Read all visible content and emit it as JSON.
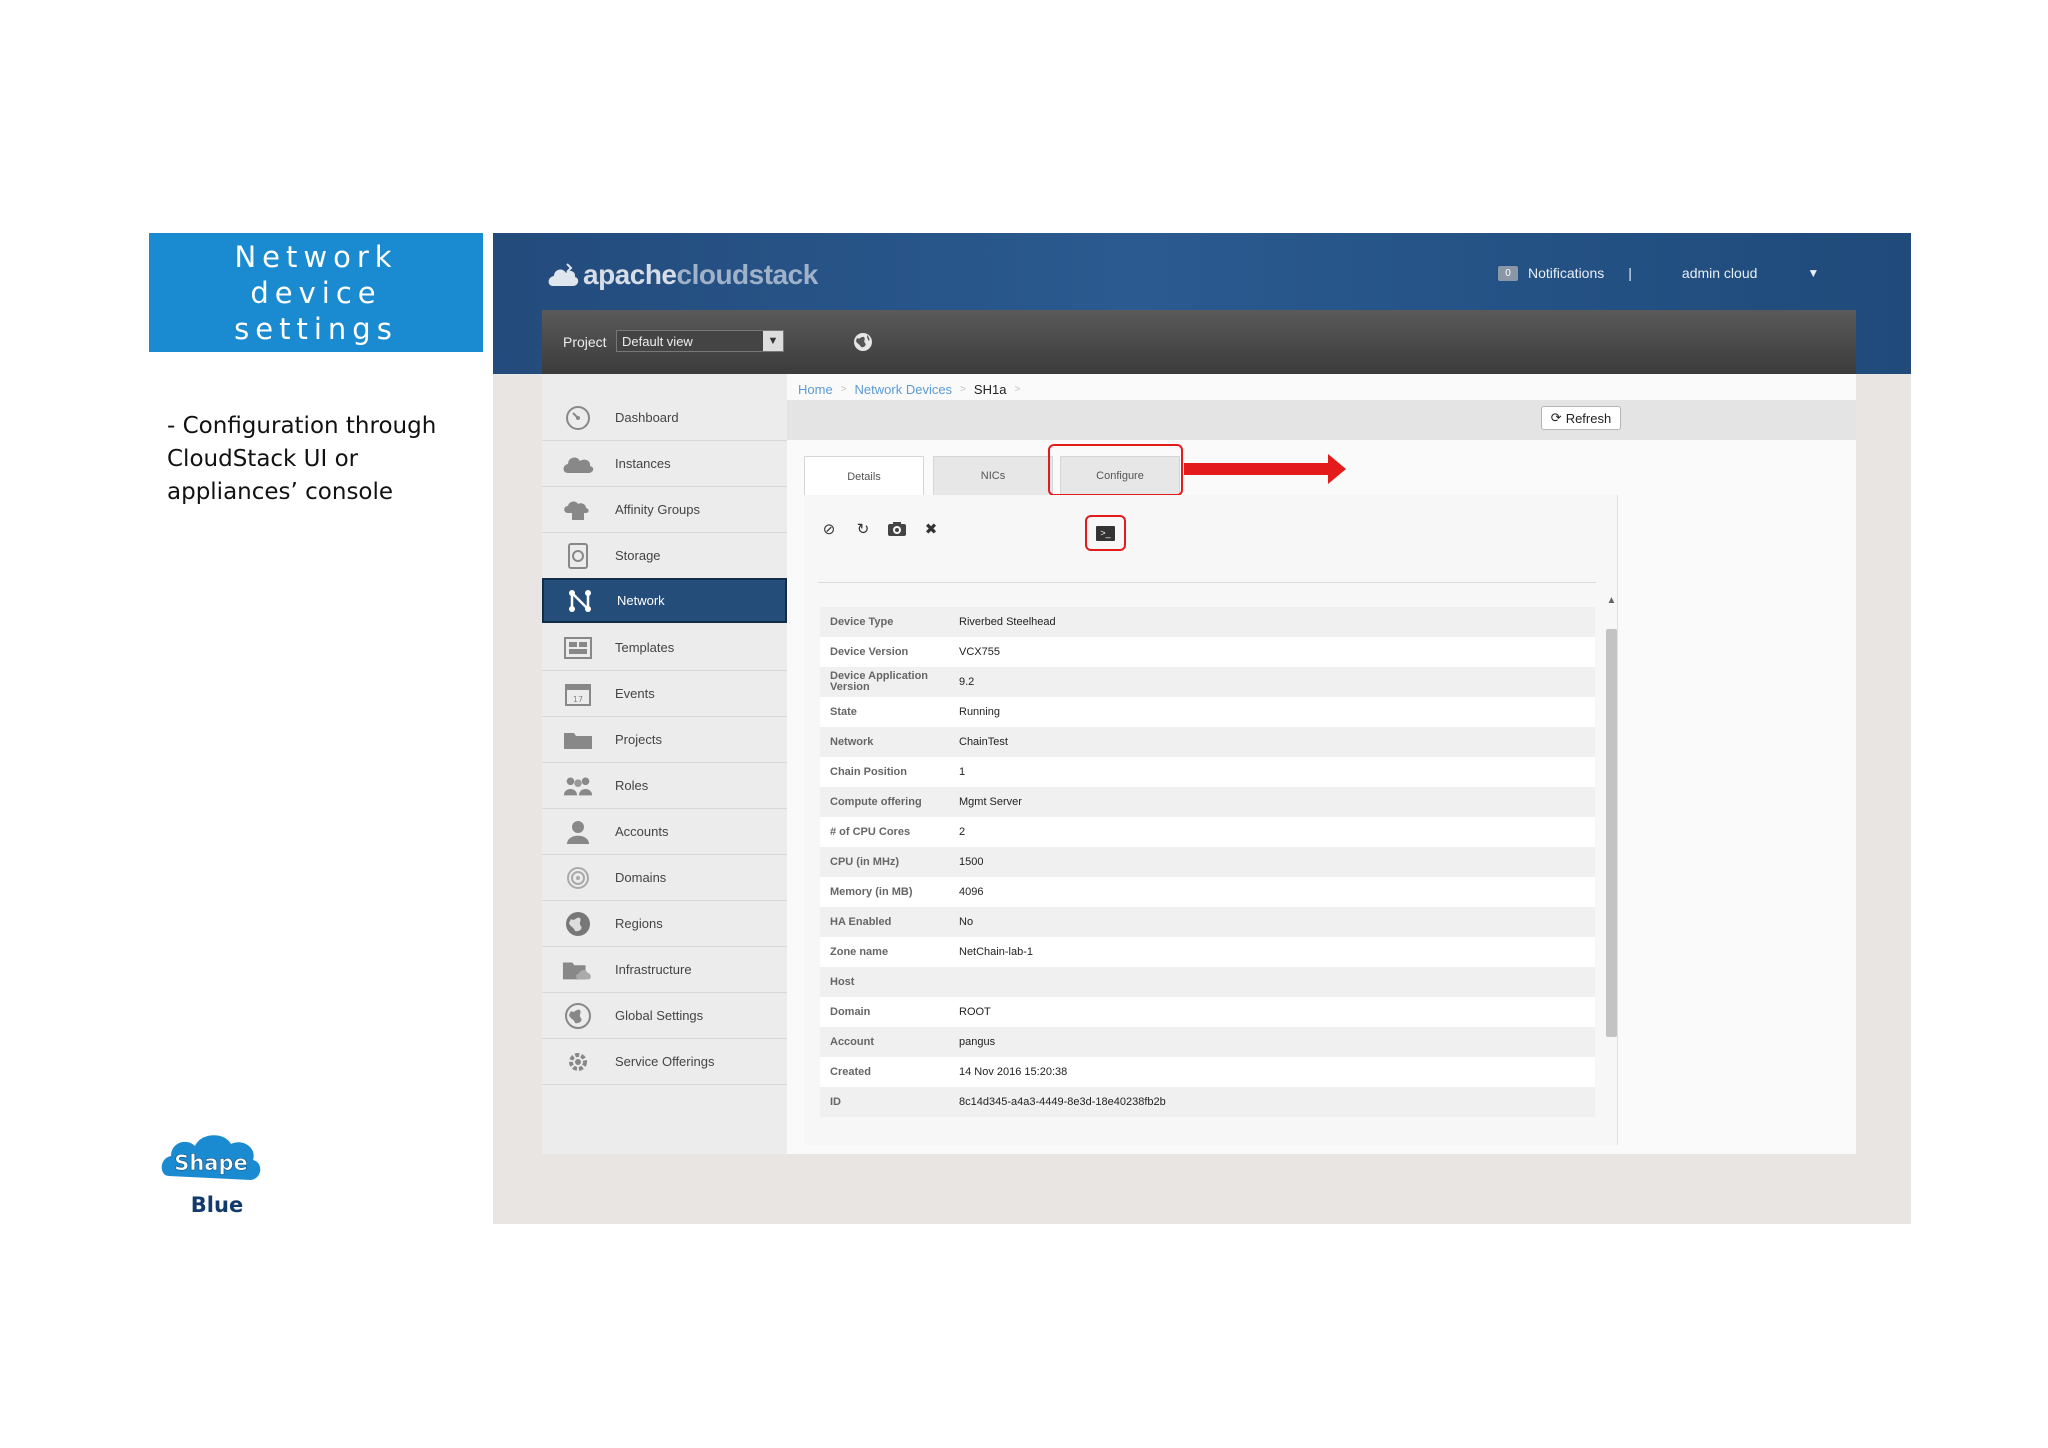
{
  "slide": {
    "title": "Network\ndevice\nsettings",
    "bullet": "- Configuration through CloudStack UI or appliances’ console",
    "logo_top": "Shape",
    "logo_bottom": "Blue"
  },
  "app": {
    "brand_a": "apache",
    "brand_b": "cloudstack",
    "notifications_count": "0",
    "notifications_label": "Notifications",
    "separator": "|",
    "user": "admin cloud"
  },
  "project": {
    "label": "Project",
    "value": "Default view"
  },
  "sidebar": {
    "items": [
      {
        "label": "Dashboard",
        "icon": "dashboard-icon"
      },
      {
        "label": "Instances",
        "icon": "cloud-icon"
      },
      {
        "label": "Affinity Groups",
        "icon": "affinity-icon"
      },
      {
        "label": "Storage",
        "icon": "storage-icon"
      },
      {
        "label": "Network",
        "icon": "network-icon"
      },
      {
        "label": "Templates",
        "icon": "templates-icon"
      },
      {
        "label": "Events",
        "icon": "calendar-icon"
      },
      {
        "label": "Projects",
        "icon": "folder-icon"
      },
      {
        "label": "Roles",
        "icon": "roles-icon"
      },
      {
        "label": "Accounts",
        "icon": "user-icon"
      },
      {
        "label": "Domains",
        "icon": "domains-icon"
      },
      {
        "label": "Regions",
        "icon": "globe-icon"
      },
      {
        "label": "Infrastructure",
        "icon": "infrastructure-icon"
      },
      {
        "label": "Global Settings",
        "icon": "global-settings-icon"
      },
      {
        "label": "Service Offerings",
        "icon": "gear-icon"
      }
    ],
    "active": "Network"
  },
  "breadcrumb": {
    "home": "Home",
    "section": "Network Devices",
    "current": "SH1a"
  },
  "toolbar": {
    "refresh_label": "Refresh"
  },
  "tabs": {
    "details": "Details",
    "nics": "NICs",
    "configure": "Configure"
  },
  "details": [
    {
      "key": "Device Type",
      "value": "Riverbed Steelhead"
    },
    {
      "key": "Device Version",
      "value": "VCX755"
    },
    {
      "key": "Device Application Version",
      "value": "9.2"
    },
    {
      "key": "State",
      "value": "Running"
    },
    {
      "key": "Network",
      "value": "ChainTest"
    },
    {
      "key": "Chain Position",
      "value": "1"
    },
    {
      "key": "Compute offering",
      "value": "Mgmt Server"
    },
    {
      "key": "# of CPU Cores",
      "value": "2"
    },
    {
      "key": "CPU (in MHz)",
      "value": "1500"
    },
    {
      "key": "Memory (in MB)",
      "value": "4096"
    },
    {
      "key": "HA Enabled",
      "value": "No"
    },
    {
      "key": "Zone name",
      "value": "NetChain-lab-1"
    },
    {
      "key": "Host",
      "value": ""
    },
    {
      "key": "Domain",
      "value": "ROOT"
    },
    {
      "key": "Account",
      "value": "pangus"
    },
    {
      "key": "Created",
      "value": "14 Nov 2016 15:20:38"
    },
    {
      "key": "ID",
      "value": "8c14d345-a4a3-4449-8e3d-18e40238fb2b"
    }
  ],
  "colors": {
    "highlight": "#e31b1b",
    "accent": "#1a8bd0",
    "active_nav": "#244d7a"
  }
}
